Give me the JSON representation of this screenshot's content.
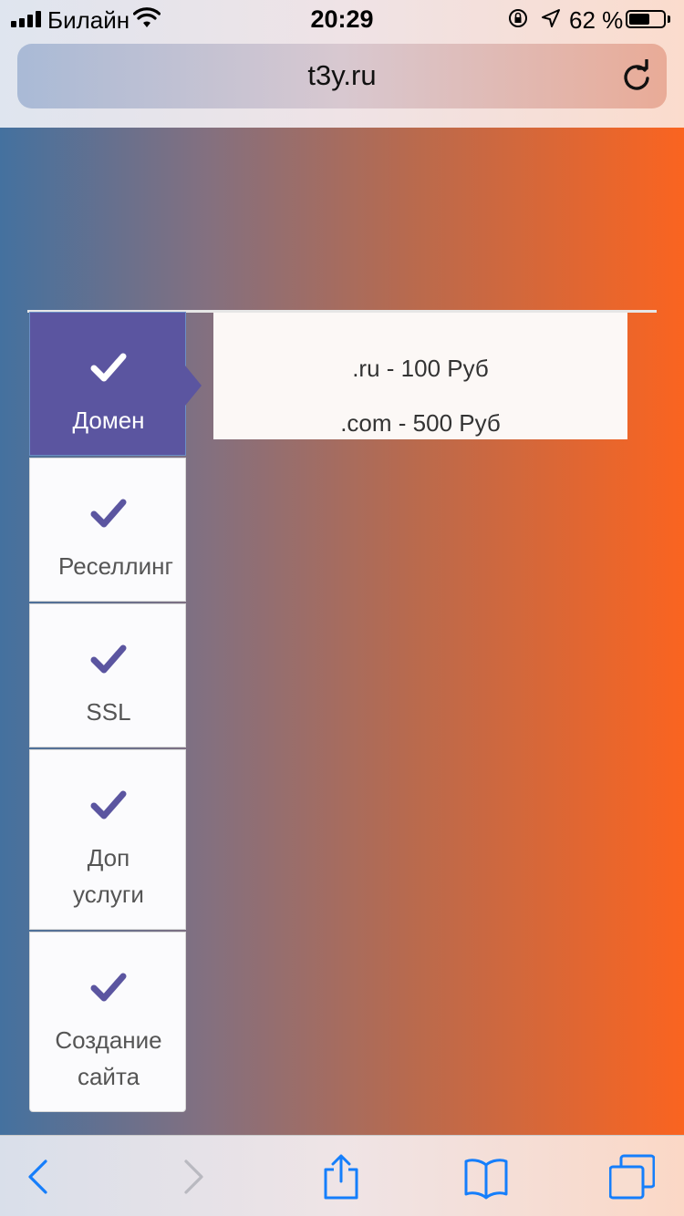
{
  "status_bar": {
    "carrier": "Билайн",
    "time": "20:29",
    "battery_percent": "62 %",
    "battery_level": 0.62,
    "icons": [
      "signal-icon",
      "wifi-icon",
      "orientation-lock-icon",
      "location-icon",
      "battery-icon"
    ]
  },
  "browser": {
    "url": "t3y.ru",
    "reload_icon": "reload-icon"
  },
  "tabs": [
    {
      "label_lines": [
        "Домен"
      ],
      "active": true,
      "icon": "check-icon"
    },
    {
      "label_lines": [
        "Реселлинг"
      ],
      "active": false,
      "icon": "check-icon"
    },
    {
      "label_lines": [
        "SSL"
      ],
      "active": false,
      "icon": "check-icon"
    },
    {
      "label_lines": [
        "Доп",
        "услуги"
      ],
      "active": false,
      "icon": "check-icon"
    },
    {
      "label_lines": [
        "Создание",
        "сайта"
      ],
      "active": false,
      "icon": "check-icon"
    }
  ],
  "prices": [
    ".ru - 100 Руб",
    ".com - 500 Руб"
  ],
  "toolbar": {
    "icons": [
      "back-icon",
      "forward-icon",
      "share-icon",
      "bookmarks-icon",
      "tabs-icon"
    ]
  },
  "colors": {
    "accent": "#5b55a0",
    "ios_blue": "#157efb",
    "gradient_left": "#44719f",
    "gradient_right": "#fa6420"
  }
}
